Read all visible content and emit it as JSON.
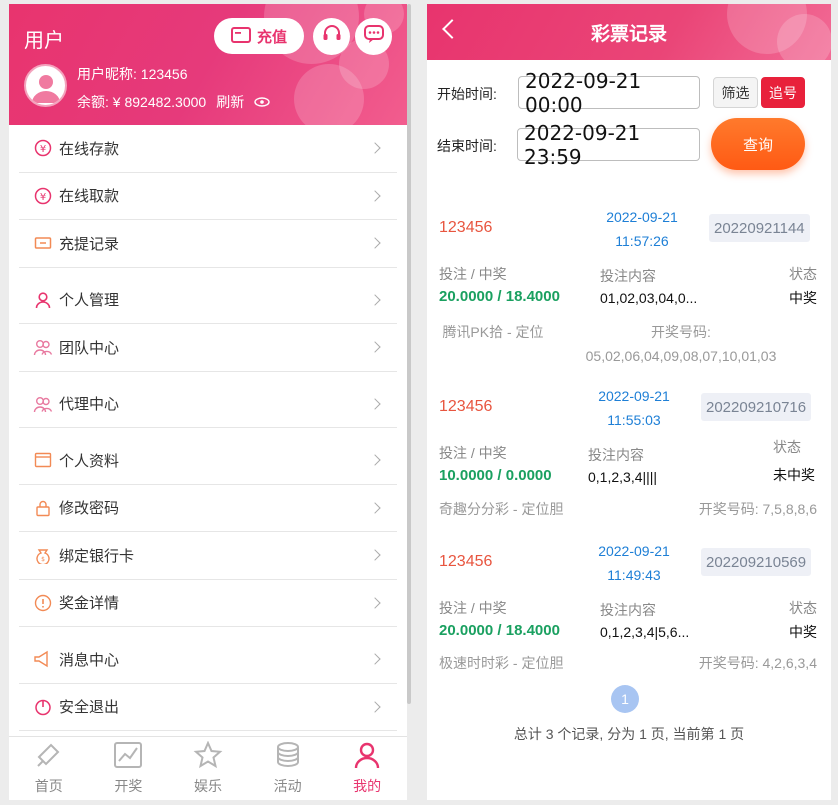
{
  "left": {
    "header": {
      "title": "用户",
      "recharge_label": "充值",
      "nickname": "用户昵称: 123456",
      "balance": "余额: ¥ 892482.3000",
      "refresh_label": "刷新"
    },
    "menu_groups": [
      [
        {
          "label": "在线存款",
          "icon": "deposit-icon"
        },
        {
          "label": "在线取款",
          "icon": "withdraw-icon"
        },
        {
          "label": "充提记录",
          "icon": "records-icon"
        }
      ],
      [
        {
          "label": "个人管理",
          "icon": "user-icon"
        },
        {
          "label": "团队中心",
          "icon": "team-icon"
        }
      ],
      [
        {
          "label": "代理中心",
          "icon": "agent-icon"
        }
      ],
      [
        {
          "label": "个人资料",
          "icon": "profile-icon"
        },
        {
          "label": "修改密码",
          "icon": "lock-icon"
        },
        {
          "label": "绑定银行卡",
          "icon": "bankcard-icon"
        },
        {
          "label": "奖金详情",
          "icon": "bonus-icon"
        }
      ],
      [
        {
          "label": "消息中心",
          "icon": "megaphone-icon"
        },
        {
          "label": "安全退出",
          "icon": "logout-icon"
        }
      ]
    ],
    "tabs": [
      {
        "label": "首页",
        "icon": "home-icon"
      },
      {
        "label": "开奖",
        "icon": "chart-icon"
      },
      {
        "label": "娱乐",
        "icon": "star-icon"
      },
      {
        "label": "活动",
        "icon": "coins-icon"
      },
      {
        "label": "我的",
        "icon": "person-icon",
        "active": true
      }
    ]
  },
  "right": {
    "title": "彩票记录",
    "filter": {
      "start_label": "开始时间:",
      "start_value": "2022-09-21 00:00",
      "end_label": "结束时间:",
      "end_value": "2022-09-21 23:59",
      "filter_btn": "筛选",
      "chase_btn": "追号",
      "query_btn": "查询"
    },
    "records": [
      {
        "user": "123456",
        "date": "2022-09-21",
        "time": "11:57:26",
        "issue": "20220921144",
        "bet_label": "投注 / 中奖",
        "amount": "20.0000 / 18.4000",
        "content_label": "投注内容",
        "content": "01,02,03,04,0...",
        "status_label": "状态",
        "status": "中奖",
        "game": "腾讯PK拾 - 定位",
        "draw_label": "开奖号码:",
        "draw": "05,02,06,04,09,08,07,10,01,03"
      },
      {
        "user": "123456",
        "date": "2022-09-21",
        "time": "11:55:03",
        "issue": "202209210716",
        "bet_label": "投注 / 中奖",
        "amount": "10.0000 / 0.0000",
        "content_label": "投注内容",
        "content": "0,1,2,3,4||||",
        "status_label": "状态",
        "status": "未中奖",
        "game": "奇趣分分彩 - 定位胆",
        "draw": "开奖号码: 7,5,8,8,6"
      },
      {
        "user": "123456",
        "date": "2022-09-21",
        "time": "11:49:43",
        "issue": "202209210569",
        "bet_label": "投注 / 中奖",
        "amount": "20.0000 / 18.4000",
        "content_label": "投注内容",
        "content": "0,1,2,3,4|5,6...",
        "status_label": "状态",
        "status": "中奖",
        "game": "极速时时彩 - 定位胆",
        "draw": "开奖号码: 4,2,6,3,4"
      }
    ],
    "pagination": {
      "current": "1",
      "summary": "总计 3 个记录, 分为 1 页, 当前第 1 页"
    }
  }
}
